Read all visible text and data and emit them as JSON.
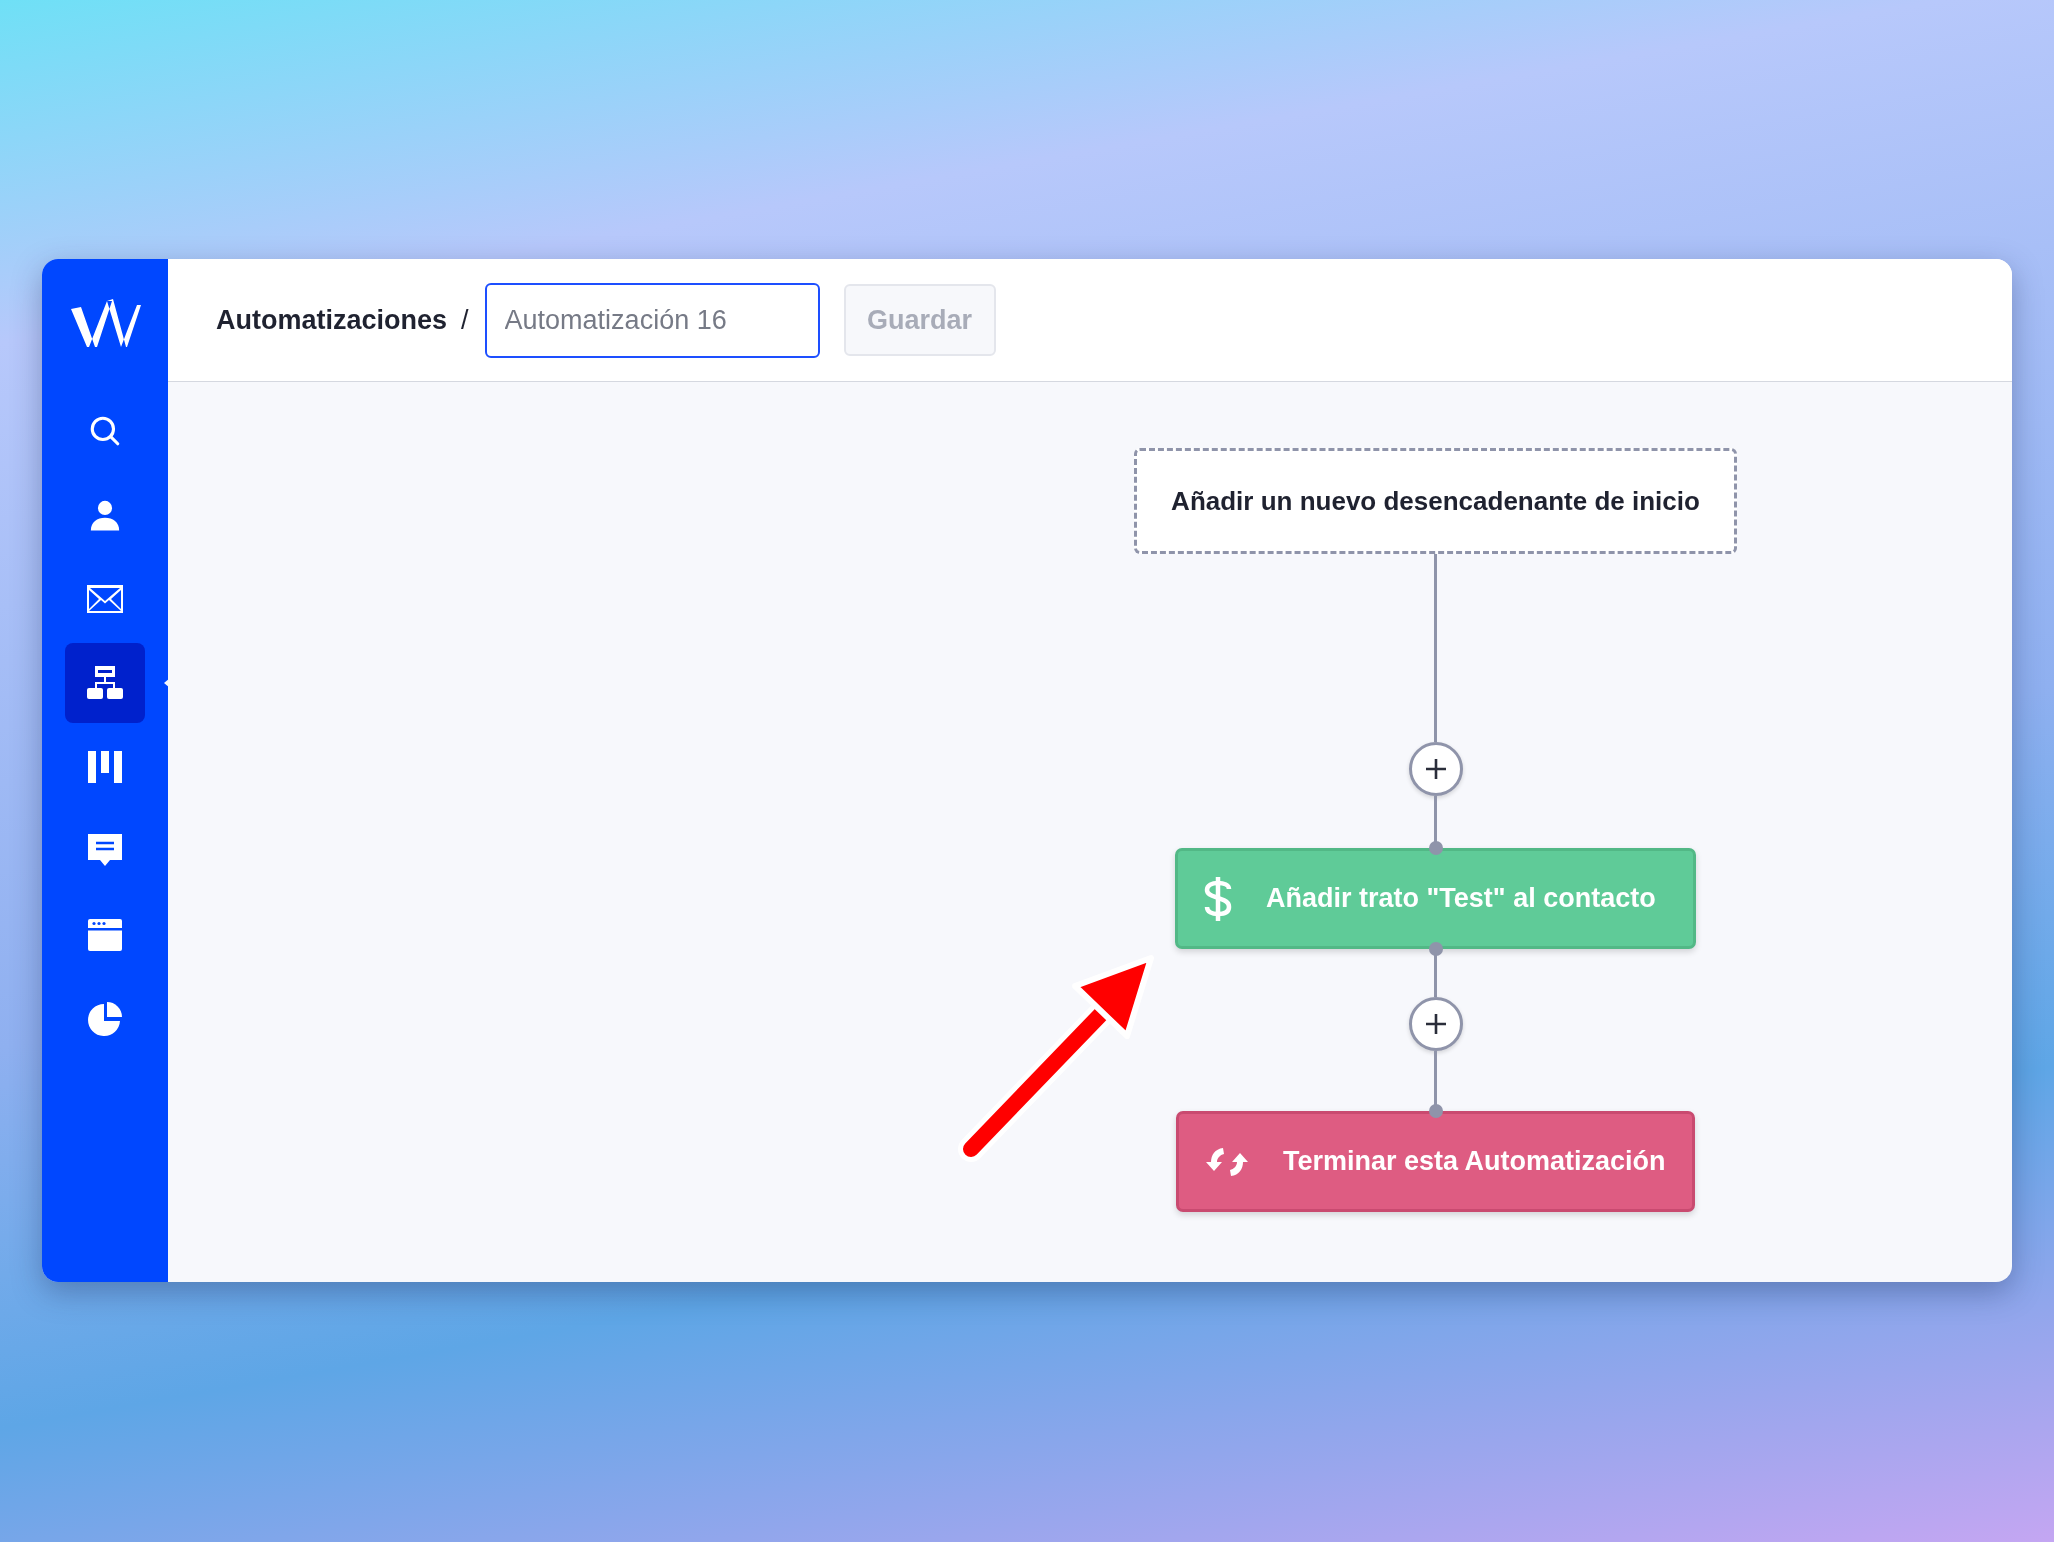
{
  "sidebar": {
    "items": [
      {
        "selected": false
      },
      {
        "selected": false
      },
      {
        "selected": false
      },
      {
        "selected": true
      },
      {
        "selected": false
      },
      {
        "selected": false
      },
      {
        "selected": false
      },
      {
        "selected": false
      }
    ]
  },
  "header": {
    "breadcrumb": "Automatizaciones",
    "separator": "/",
    "name_field": {
      "placeholder": "Automatización 16"
    },
    "save_button": {
      "label": "Guardar",
      "disabled": true
    }
  },
  "flow": {
    "nodes": [
      {
        "kind": "trigger",
        "label": "Añadir un nuevo desencadenante de inicio"
      },
      {
        "kind": "deal",
        "label": "Añadir trato \"Test\" al contacto"
      },
      {
        "kind": "end",
        "label": "Terminar esta Automatización"
      }
    ]
  }
}
